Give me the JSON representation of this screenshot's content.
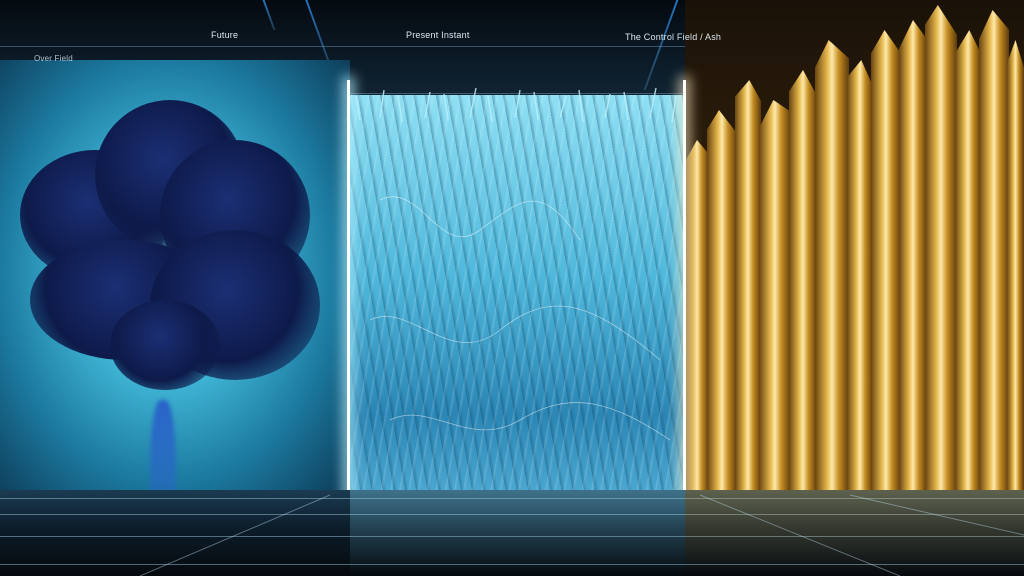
{
  "labels": {
    "future": "Future",
    "present": "Present Instant",
    "control": "The Control Field / Ash",
    "left_zone": "Over Field"
  },
  "palette": {
    "smoke_light": "#8be3f2",
    "smoke_dark": "#0d1a4a",
    "water": "#4fb8dc",
    "crystal_gold": "#e3b54a",
    "floor": "#0c1c29"
  }
}
